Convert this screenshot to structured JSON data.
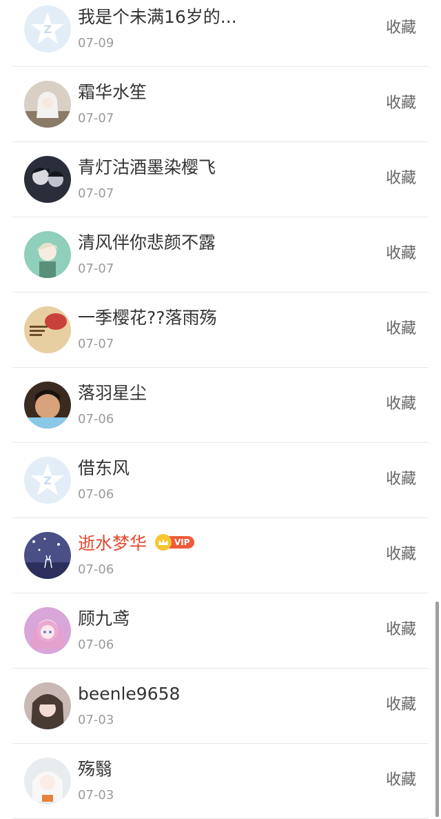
{
  "action_label": "收藏",
  "vip_label": "VIP",
  "items": [
    {
      "name": "我是个未满16岁的...",
      "date": "07-09",
      "avatar": "default-qzone"
    },
    {
      "name": "霜华水笙",
      "date": "07-07",
      "avatar": "anime-white-hair"
    },
    {
      "name": "青灯沽酒墨染樱飞",
      "date": "07-07",
      "avatar": "anime-dark-boys"
    },
    {
      "name": "清风伴你悲颜不露",
      "date": "07-07",
      "avatar": "anime-green-boy"
    },
    {
      "name": "一季樱花??落雨殇",
      "date": "07-07",
      "avatar": "drawing-red-hat"
    },
    {
      "name": "落羽星尘",
      "date": "07-06",
      "avatar": "photo-boy"
    },
    {
      "name": "借东风",
      "date": "07-06",
      "avatar": "default-qzone"
    },
    {
      "name": "逝水梦华",
      "date": "07-06",
      "avatar": "night-deer",
      "vip": true
    },
    {
      "name": "顾九鸢",
      "date": "07-06",
      "avatar": "anime-pink-girl"
    },
    {
      "name": "beenle9658",
      "date": "07-03",
      "avatar": "anime-dark-girl"
    },
    {
      "name": "殇翳",
      "date": "07-03",
      "avatar": "anime-white-girl"
    }
  ],
  "colors": {
    "vip_name": "#e0482f",
    "vip_pill": "#f05a3a",
    "crown": "#f7c531",
    "text_primary": "#333333",
    "text_secondary": "#9a9a9a",
    "divider": "#e6e6e6"
  }
}
